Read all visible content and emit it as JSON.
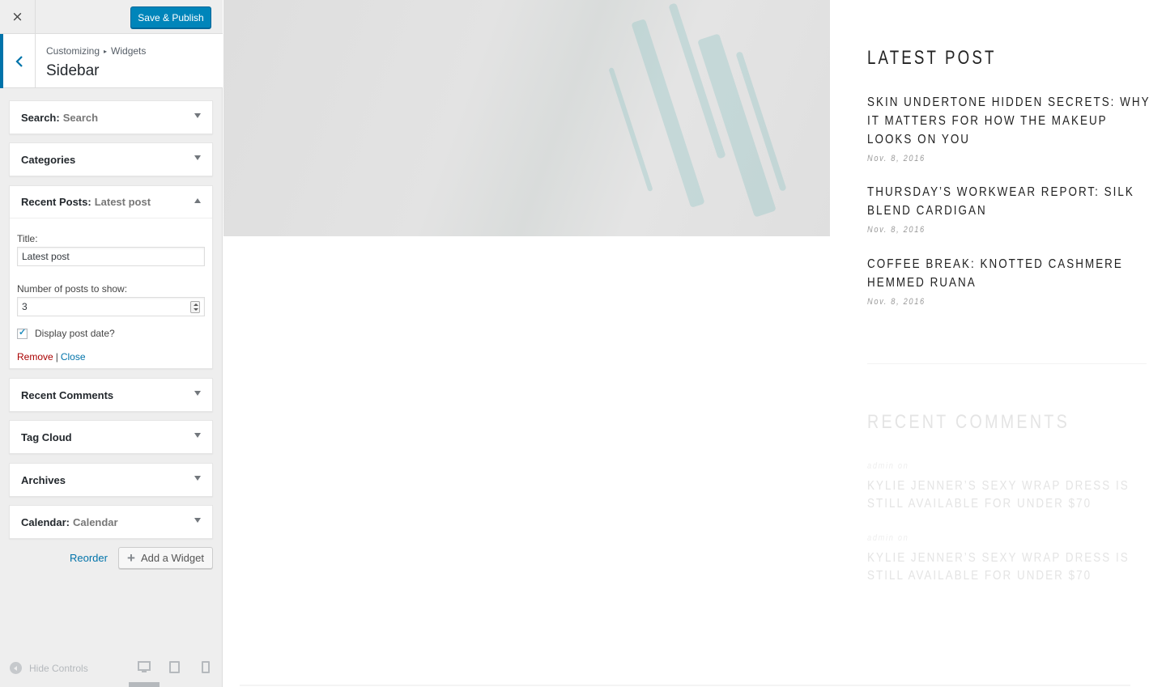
{
  "customizer": {
    "close_icon": "×",
    "save_label": "Save & Publish",
    "breadcrumb": {
      "root": "Customizing",
      "separator": "▸",
      "section": "Widgets"
    },
    "section_title": "Sidebar",
    "widgets": [
      {
        "name": "Search:",
        "title": "Search"
      },
      {
        "name": "Categories",
        "title": ""
      },
      {
        "name": "Recent Posts:",
        "title": "Latest post",
        "expanded": true
      },
      {
        "name": "Recent Comments",
        "title": ""
      },
      {
        "name": "Tag Cloud",
        "title": ""
      },
      {
        "name": "Archives",
        "title": ""
      },
      {
        "name": "Calendar:",
        "title": "Calendar"
      }
    ],
    "recent_posts_form": {
      "title_label": "Title:",
      "title_value": "Latest post",
      "number_label": "Number of posts to show:",
      "number_value": "3",
      "display_date_label": "Display post date?",
      "display_date_checked": true,
      "remove_label": "Remove",
      "pipe": "|",
      "close_label": "Close"
    },
    "reorder_label": "Reorder",
    "add_widget_label": "Add a Widget",
    "add_icon": "+",
    "hide_controls_label": "Hide Controls"
  },
  "preview": {
    "latest_heading": "LATEST POST",
    "posts": [
      {
        "title": "SKIN UNDERTONE HIDDEN SECRETS: WHY IT MATTERS FOR HOW THE MAKEUP LOOKS ON YOU",
        "date": "Nov. 8, 2016"
      },
      {
        "title": "THURSDAY’S WORKWEAR REPORT: SILK BLEND CARDIGAN",
        "date": "Nov. 8, 2016"
      },
      {
        "title": "COFFEE BREAK: KNOTTED CASHMERE HEMMED RUANA",
        "date": "Nov. 8, 2016"
      }
    ],
    "comments_heading": "RECENT COMMENTS",
    "comments": [
      {
        "meta": "admin on",
        "title": "KYLIE JENNER’S SEXY WRAP DRESS IS STILL AVAILABLE FOR UNDER $70"
      },
      {
        "meta": "admin on",
        "title": "KYLIE JENNER’S SEXY WRAP DRESS IS STILL AVAILABLE FOR UNDER $70"
      }
    ]
  },
  "colors": {
    "primary_button": "#0085ba",
    "accent_blue": "#0073aa",
    "remove_red": "#aa0000",
    "sidebar_bg": "#eeeeee"
  }
}
